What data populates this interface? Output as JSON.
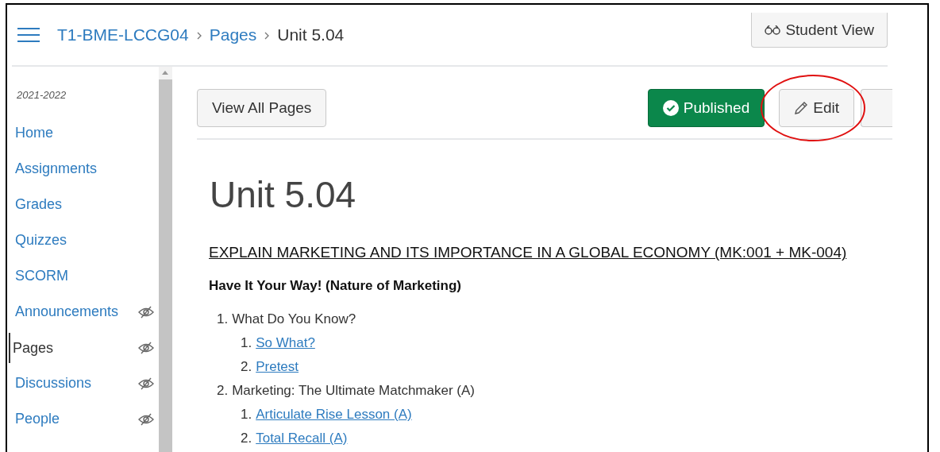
{
  "breadcrumb": [
    {
      "label": "T1-BME-LCCG04",
      "kind": "link"
    },
    {
      "label": "Pages",
      "kind": "link"
    },
    {
      "label": "Unit 5.04",
      "kind": "current"
    }
  ],
  "student_view_button": {
    "label": "Student View"
  },
  "sidebar": {
    "term": "2021-2022",
    "items": [
      {
        "label": "Home",
        "selected": false,
        "hidden": false
      },
      {
        "label": "Assignments",
        "selected": false,
        "hidden": false
      },
      {
        "label": "Grades",
        "selected": false,
        "hidden": false
      },
      {
        "label": "Quizzes",
        "selected": false,
        "hidden": false
      },
      {
        "label": "SCORM",
        "selected": false,
        "hidden": false
      },
      {
        "label": "Announcements",
        "selected": false,
        "hidden": true
      },
      {
        "label": "Pages",
        "selected": true,
        "hidden": true
      },
      {
        "label": "Discussions",
        "selected": false,
        "hidden": true
      },
      {
        "label": "People",
        "selected": false,
        "hidden": true
      }
    ]
  },
  "toolbar": {
    "view_all_button": "View All Pages",
    "publish_button": {
      "label": "Published",
      "published": true
    },
    "edit_button": "Edit"
  },
  "page": {
    "title": "Unit 5.04",
    "section_heading": "EXPLAIN MARKETING AND ITS IMPORTANCE IN A GLOBAL ECONOMY (MK:001 + MK-004)",
    "subheading": "Have It Your Way! (Nature of Marketing)",
    "outline": [
      {
        "number": "1.",
        "text": "What Do You Know?",
        "kind": "text",
        "children": [
          {
            "number": "1.",
            "text": "So What?",
            "kind": "link"
          },
          {
            "number": "2.",
            "text": "Pretest",
            "kind": "link"
          }
        ]
      },
      {
        "number": "2.",
        "text": "Marketing: The Ultimate Matchmaker (A)",
        "kind": "text",
        "children": [
          {
            "number": "1.",
            "text": "Articulate Rise Lesson (A)",
            "kind": "link"
          },
          {
            "number": "2.",
            "text": "Total Recall (A)",
            "kind": "link"
          }
        ]
      }
    ]
  }
}
